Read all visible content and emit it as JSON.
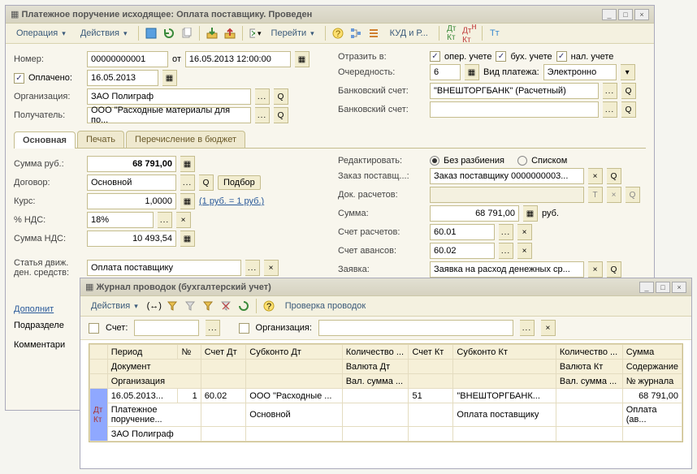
{
  "win1": {
    "title": "Платежное поручение исходящее: Оплата поставщику. Проведен",
    "toolbar": {
      "op": "Операция",
      "actions": "Действия",
      "goto": "Перейти",
      "kud": "КУД и Р..."
    },
    "number_lbl": "Номер:",
    "number": "00000000001",
    "ot": "от",
    "date": "16.05.2013 12:00:00",
    "paid_lbl": "Оплачено:",
    "paid_date": "16.05.2013",
    "org_lbl": "Организация:",
    "org": "ЗАО Полиграф",
    "recv_lbl": "Получатель:",
    "recv": "ООО \"Расходные материалы для по...",
    "reflect_lbl": "Отразить в:",
    "reflect_op": "опер. учете",
    "reflect_bu": "бух. учете",
    "reflect_nal": "нал. учете",
    "prio_lbl": "Очередность:",
    "priority": "6",
    "paytype_lbl": "Вид платежа:",
    "paytype": "Электронно",
    "bank1_lbl": "Банковский счет:",
    "bank1": "\"ВНЕШТОРГБАНК\" (Расчетный)",
    "bank2_lbl": "Банковский счет:",
    "tabs": {
      "t1": "Основная",
      "t2": "Печать",
      "t3": "Перечисление в бюджет"
    },
    "sum_lbl": "Сумма руб.:",
    "sum": "68 791,00",
    "contract_lbl": "Договор:",
    "contract": "Основной",
    "pick": "Подбор",
    "rate_lbl": "Курс:",
    "rate": "1,0000",
    "ratehint": "(1 руб. = 1 руб.)",
    "vatp_lbl": "% НДС:",
    "vatp": "18%",
    "vat_lbl": "Сумма НДС:",
    "vat": "10 493,54",
    "edit_lbl": "Редактировать:",
    "edit_nosplit": "Без разбиения",
    "edit_list": "Списком",
    "order_lbl": "Заказ поставщ...:",
    "order": "Заказ поставщику 0000000003...",
    "docpay_lbl": "Док. расчетов:",
    "sum2_lbl": "Сумма:",
    "sum2": "68 791,00",
    "rub": "руб.",
    "accp_lbl": "Счет расчетов:",
    "accp": "60.01",
    "acca_lbl": "Счет авансов:",
    "acca": "60.02",
    "flow_lbl": "Статья движ. ден. средств:",
    "flow": "Оплата поставщику",
    "req_lbl": "Заявка:",
    "req": "Заявка на расход денежных ср...",
    "extra": "Дополнит",
    "subdiv": "Подразделе",
    "comment": "Комментари"
  },
  "win2": {
    "title": "Журнал проводок (бухгалтерский учет)",
    "toolbar": {
      "actions": "Действия",
      "check": "Проверка проводок"
    },
    "filter": {
      "acc_lbl": "Счет:",
      "org_lbl": "Организация:"
    },
    "head": {
      "period": "Период",
      "num": "№",
      "dt": "Счет Дт",
      "sdt": "Субконто Дт",
      "qtydt": "Количество ...",
      "kt": "Счет Кт",
      "skt": "Субконто Кт",
      "qtykt": "Количество ...",
      "sum": "Сумма",
      "doc": "Документ",
      "curdt": "Валюта Дт",
      "curkt": "Валюта Кт",
      "cont": "Содержание",
      "org": "Организация",
      "vsumdt": "Вал. сумма ...",
      "vsumkt": "Вал. сумма ...",
      "jnum": "№ журнала"
    },
    "rows": [
      {
        "period": "16.05.2013...",
        "num": "1",
        "dt": "60.02",
        "sdt": "ООО \"Расходные ...",
        "qtydt": "",
        "kt": "51",
        "skt": "\"ВНЕШТОРГБАНК...",
        "qtykt": "",
        "sum": "68 791,00",
        "doc": "Платежное поручение...",
        "curdt": "",
        "sdt2": "Основной",
        "curkt": "",
        "skt2": "Оплата поставщику",
        "cont": "Оплата (ав...",
        "org": "ЗАО Полиграф"
      }
    ]
  }
}
